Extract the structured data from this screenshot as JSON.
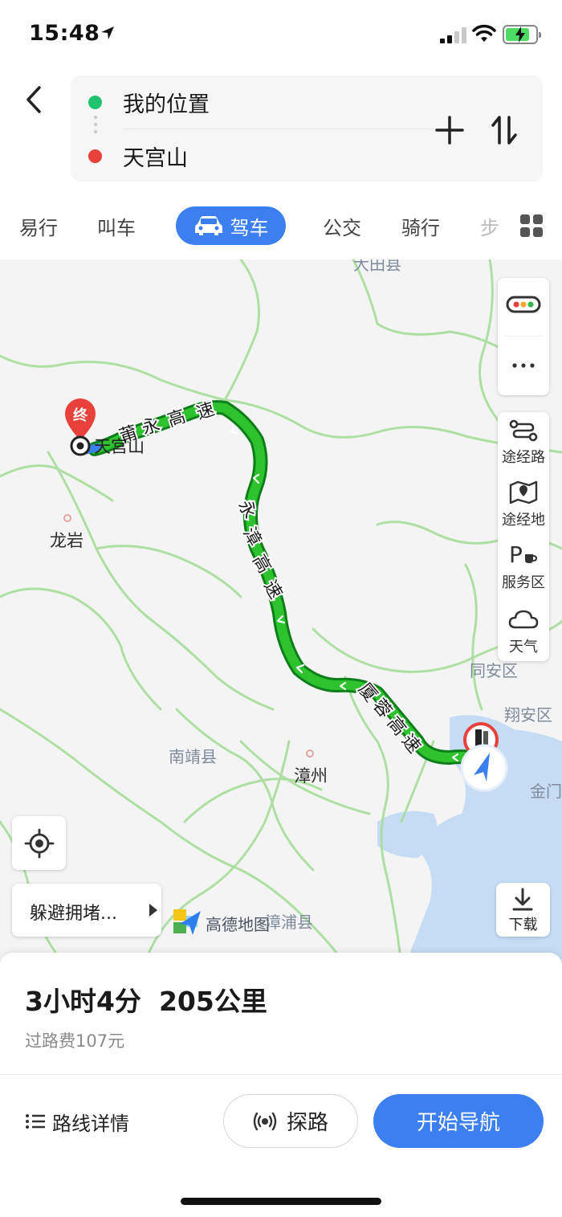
{
  "status_bar": {
    "time": "15:48",
    "battery_charging": true,
    "battery_level": 0.8
  },
  "route_input": {
    "origin": "我的位置",
    "destination": "天宫山",
    "origin_color": "#1ec36b",
    "destination_color": "#e8403a"
  },
  "mode_tabs": {
    "items": [
      "易行",
      "叫车",
      "驾车",
      "公交",
      "骑行",
      "步"
    ],
    "active": "驾车"
  },
  "map": {
    "place_labels": [
      "大田县",
      "龙岩",
      "南靖县",
      "漳州",
      "漳浦县",
      "同安区",
      "翔安区",
      "金门"
    ],
    "destination_label": "天宫山",
    "end_marker": "终",
    "road_labels": {
      "road1": [
        "莆",
        "永",
        "高",
        "速"
      ],
      "road2": [
        "永",
        "漳",
        "高",
        "速"
      ],
      "road3": [
        "厦",
        "蓉",
        "高",
        "速"
      ]
    },
    "side_panel": {
      "via_route": "途经路",
      "via_place": "途经地",
      "service_area": "服务区",
      "weather": "天气"
    },
    "avoid_congestion": "躲避拥堵...",
    "provider": "高德地图",
    "download": "下载",
    "route_color": "#1fa81f",
    "accent_color": "#3b7ff0"
  },
  "summary": {
    "duration": "3小时4分",
    "distance": "205公里",
    "toll": "过路费107元"
  },
  "actions": {
    "details": "路线详情",
    "probe": "探路",
    "start_navigation": "开始导航"
  }
}
